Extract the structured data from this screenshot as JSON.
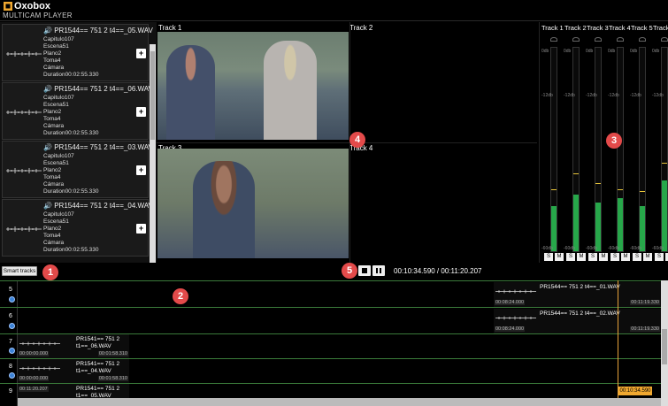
{
  "app": {
    "brand": "Oxobox",
    "subtitle": "MULTICAM PLAYER"
  },
  "clips": [
    {
      "name": "PR1544== 751 2 t4==_05.WAV",
      "capitulo": "Capitulo107",
      "escena": "Escena51",
      "plano": "Plano2",
      "toma": "Toma4",
      "camara": "Cámara",
      "duration": "Duration00:02:55.330",
      "add_label": "+"
    },
    {
      "name": "PR1544== 751 2 t4==_06.WAV",
      "capitulo": "Capitulo107",
      "escena": "Escena51",
      "plano": "Plano2",
      "toma": "Toma4",
      "camara": "Cámara",
      "duration": "Duration00:02:55.330",
      "add_label": "+"
    },
    {
      "name": "PR1544== 751 2 t4==_03.WAV",
      "capitulo": "Capitulo107",
      "escena": "Escena51",
      "plano": "Plano2",
      "toma": "Toma4",
      "camara": "Cámara",
      "duration": "Duration00:02:55.330",
      "add_label": "+"
    },
    {
      "name": "PR1544== 751 2 t4==_04.WAV",
      "capitulo": "Capitulo107",
      "escena": "Escena51",
      "plano": "Plano2",
      "toma": "Toma4",
      "camara": "Cámara",
      "duration": "Duration00:02:55.330",
      "add_label": "+"
    }
  ],
  "video": {
    "tracks": [
      "Track 1",
      "Track 2",
      "Track 3",
      "Track 4"
    ]
  },
  "meters": {
    "tracks": [
      "Track 1",
      "Track 2",
      "Track 3",
      "Track 4",
      "Track 5",
      "Track 6"
    ],
    "db_labels": [
      "0db",
      "-12db",
      "-60db"
    ],
    "levels": [
      0.22,
      0.28,
      0.24,
      0.26,
      0.22,
      0.35
    ],
    "peaks": [
      0.3,
      0.38,
      0.33,
      0.3,
      0.29,
      0.43
    ],
    "solo_label": "S",
    "mute_label": "M",
    "fill_color": "#27a74a",
    "peak_color": "#e8c53a"
  },
  "callouts": [
    "1",
    "2",
    "3",
    "4",
    "5"
  ],
  "controls": {
    "smart_tracks": "Smart tracks",
    "timecode": "00:10:34.590 / 00:11:20.207"
  },
  "timeline": {
    "rows": [
      {
        "number": "5"
      },
      {
        "number": "6"
      },
      {
        "number": "7"
      },
      {
        "number": "8"
      },
      {
        "number": "9"
      }
    ],
    "blocks": [
      {
        "title": "PR1544== 751 2 t4==_01.WAV",
        "start": "00:08:24.000",
        "end": "00:11:19.330"
      },
      {
        "title": "PR1544== 751 2 t4==_02.WAV",
        "start": "00:08:24.000",
        "end": "00:11:19.330"
      },
      {
        "title": "PR1541== 751 2 t1==_06.WAV",
        "start": "00:00:00.000",
        "end": "00:01:58.310"
      },
      {
        "title": "PR1541== 751 2 t1==_04.WAV",
        "start": "00:00:00.000",
        "end": "00:01:58.310"
      },
      {
        "title": "PR1541== 751 2 t1==_05.WAV",
        "start": "00:11:20.207",
        "end": ""
      }
    ],
    "playhead_tc": "00:10:34.590",
    "playhead_color": "#f0a830"
  }
}
